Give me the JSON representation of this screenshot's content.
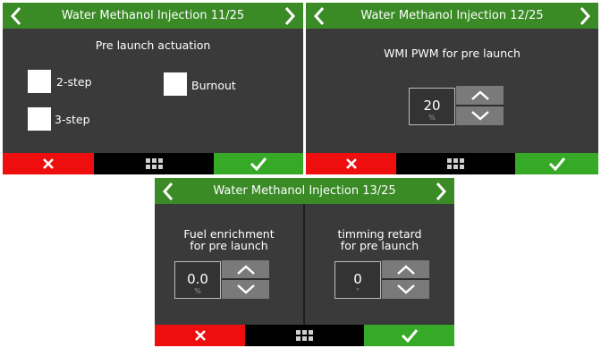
{
  "colors": {
    "header": "#3a8a26",
    "cancel": "#ef0e0e",
    "confirm": "#36a926",
    "panel": "#3a3a3a"
  },
  "screens": [
    {
      "title": "Water Methanol Injection 11/25",
      "heading": "Pre launch actuation",
      "checkboxes": [
        {
          "label": "2-step"
        },
        {
          "label": "Burnout"
        },
        {
          "label": "3-step"
        }
      ]
    },
    {
      "title": "Water Methanol Injection 12/25",
      "heading": "WMI PWM for pre launch",
      "stepper": {
        "value": "20",
        "unit": "%"
      }
    },
    {
      "title": "Water Methanol Injection 13/25",
      "left": {
        "heading_line1": "Fuel enrichment",
        "heading_line2": "for pre launch",
        "value": "0.0",
        "unit": "%"
      },
      "right": {
        "heading_line1": "timming retard",
        "heading_line2": "for pre launch",
        "value": "0",
        "unit": "°"
      }
    }
  ],
  "icons": {
    "prev": "chevron-left-icon",
    "next": "chevron-right-icon",
    "cancel": "close-icon",
    "menu": "grid-menu-icon",
    "confirm": "check-icon",
    "up": "chevron-up-icon",
    "down": "chevron-down-icon"
  }
}
